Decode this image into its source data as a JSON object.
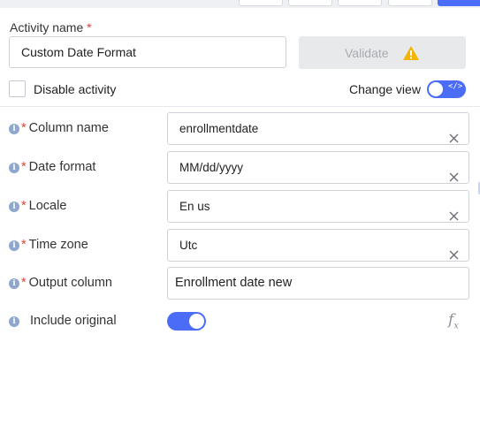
{
  "activity": {
    "label": "Activity name",
    "required_mark": "*",
    "value": "Custom Date Format"
  },
  "validate": {
    "label": "Validate",
    "icon": "warning-icon",
    "icon_color": "#f5b400"
  },
  "disable": {
    "label": "Disable activity",
    "checked": false
  },
  "change_view": {
    "label": "Change view",
    "on": true
  },
  "fields": [
    {
      "label": "Column name",
      "required": "*",
      "value": "enrollmentdate",
      "clearable": true
    },
    {
      "label": "Date format",
      "required": "*",
      "value": "MM/dd/yyyy",
      "clearable": true
    },
    {
      "label": "Locale",
      "required": "*",
      "value": "En us",
      "clearable": true
    },
    {
      "label": "Time zone",
      "required": "*",
      "value": "Utc",
      "clearable": true
    },
    {
      "label": "Output column",
      "required": "*",
      "value": "Enrollment date new",
      "clearable": false
    }
  ],
  "include_original": {
    "label": "Include original",
    "on": true
  },
  "fx_icon": "fx",
  "fx_sub": "x",
  "info_glyph": "i",
  "colors": {
    "accent": "#4a6cf7",
    "required": "#e0403a",
    "info": "#8fa6cf"
  }
}
